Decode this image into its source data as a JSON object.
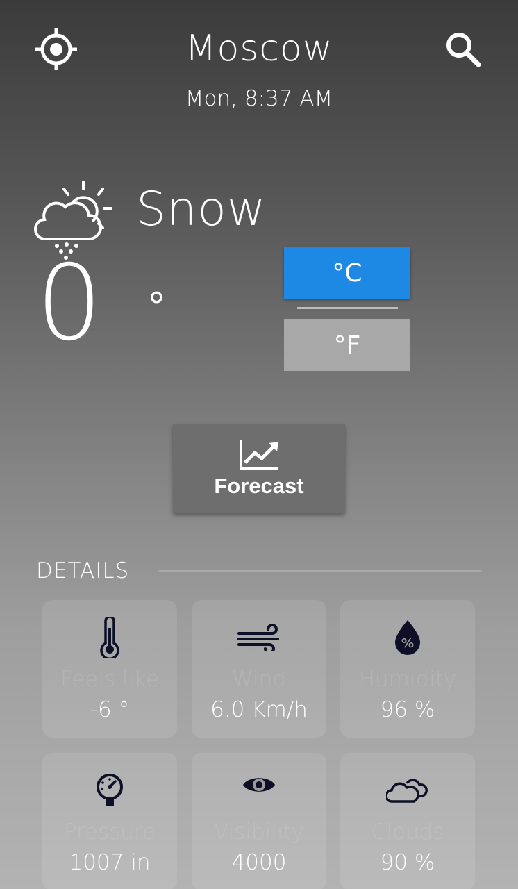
{
  "header": {
    "city": "Moscow",
    "datetime": "Mon, 8:37 AM",
    "location_icon": "crosshair-icon",
    "search_icon": "search-icon"
  },
  "current": {
    "condition": "Snow",
    "condition_icon": "snow-cloud-sun-icon",
    "temperature": "0",
    "degree_symbol": "°"
  },
  "units": {
    "celsius_label": "°C",
    "fahrenheit_label": "°F",
    "selected": "celsius"
  },
  "forecast_button": {
    "label": "Forecast",
    "icon": "trending-up-chart-icon"
  },
  "details": {
    "title": "DETAILS",
    "cards": [
      {
        "label": "Feels like",
        "value": "-6 °",
        "icon": "thermometer-icon"
      },
      {
        "label": "Wind",
        "value": "6.0 Km/h",
        "icon": "wind-icon"
      },
      {
        "label": "Humidity",
        "value": "96 %",
        "icon": "humidity-drop-icon"
      },
      {
        "label": "Pressure",
        "value": "1007 in",
        "icon": "pressure-gauge-icon"
      },
      {
        "label": "Visibility",
        "value": "4000",
        "icon": "eye-icon"
      },
      {
        "label": "Clouds",
        "value": "90 %",
        "icon": "clouds-icon"
      }
    ]
  },
  "colors": {
    "accent": "#1e88e5",
    "unselected_unit": "#a8a8a8",
    "forecast_button": "#6e6e6e",
    "detail_icon": "#0d1026"
  }
}
